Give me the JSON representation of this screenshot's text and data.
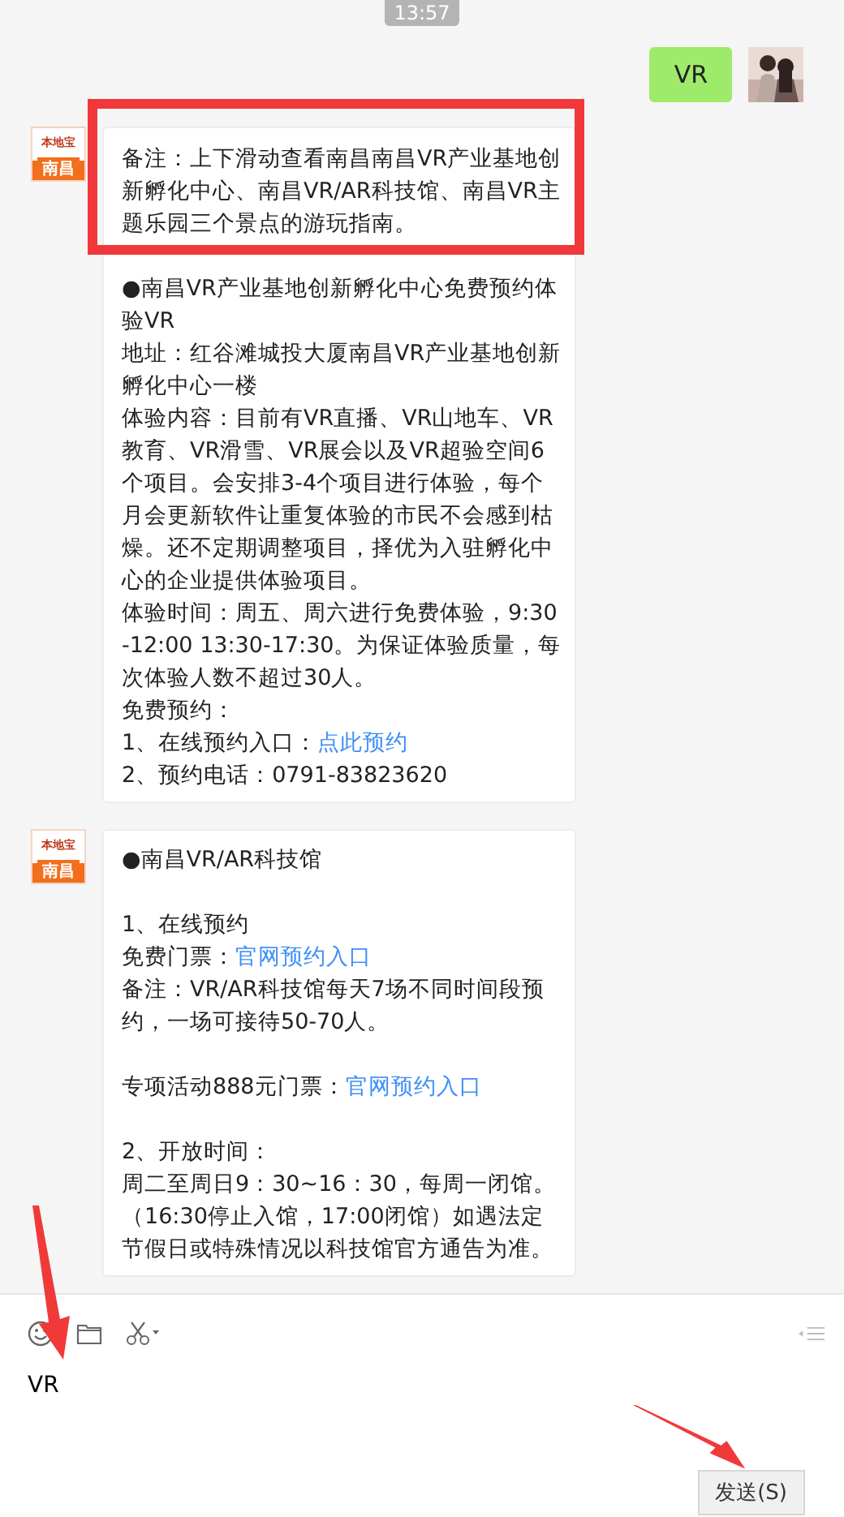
{
  "timestamp": "13:57",
  "messages": [
    {
      "kind": "sent",
      "avatar": {
        "kind": "picture"
      },
      "lines": [
        {
          "kind": "text",
          "text": "VR"
        }
      ]
    },
    {
      "kind": "received",
      "avatar": {
        "kind": "logo",
        "brand": "本地宝",
        "city": "南昌"
      },
      "highlight_first": true,
      "lines": [
        {
          "kind": "text",
          "text": "备注：上下滑动查看南昌南昌VR产业基地创新孵化中心、南昌VR/AR科技馆、南昌VR主题乐园三个景点的游玩指南。"
        },
        {
          "kind": "gap"
        },
        {
          "kind": "text",
          "text": "●南昌VR产业基地创新孵化中心免费预约体验VR"
        },
        {
          "kind": "text",
          "text": "地址：红谷滩城投大厦南昌VR产业基地创新孵化中心一楼"
        },
        {
          "kind": "text",
          "text": "体验内容：目前有VR直播、VR山地车、VR教育、VR滑雪、VR展会以及VR超验空间6个项目。会安排3-4个项目进行体验，每个月会更新软件让重复体验的市民不会感到枯燥。还不定期调整项目，择优为入驻孵化中心的企业提供体验项目。"
        },
        {
          "kind": "text",
          "text": "体验时间：周五、周六进行免费体验，9:30-12:00 13:30-17:30。为保证体验质量，每次体验人数不超过30人。"
        },
        {
          "kind": "text",
          "text": "免费预约："
        },
        {
          "kind": "link",
          "text": "1、在线预约入口：",
          "link": "点此预约"
        },
        {
          "kind": "text",
          "text": "2、预约电话：0791-83823620"
        }
      ]
    },
    {
      "kind": "received",
      "avatar": {
        "kind": "logo",
        "brand": "本地宝",
        "city": "南昌"
      },
      "highlight_first": false,
      "lines": [
        {
          "kind": "text",
          "text": "●南昌VR/AR科技馆"
        },
        {
          "kind": "gap"
        },
        {
          "kind": "text",
          "text": "1、在线预约"
        },
        {
          "kind": "link",
          "text": "免费门票：",
          "link": "官网预约入口"
        },
        {
          "kind": "text",
          "text": "备注：VR/AR科技馆每天7场不同时间段预约，一场可接待50-70人。"
        },
        {
          "kind": "gap"
        },
        {
          "kind": "link",
          "text": "专项活动888元门票：",
          "link": "官网预约入口"
        },
        {
          "kind": "gap"
        },
        {
          "kind": "text",
          "text": "2、开放时间："
        },
        {
          "kind": "text",
          "text": "周二至周日9：30~16：30，每周一闭馆。（16:30停止入馆，17:00闭馆）如遇法定节假日或特殊情况以科技馆官方通告为准。"
        }
      ]
    }
  ],
  "composer": {
    "value": "VR",
    "send_button": "发送(S)"
  },
  "annotations": [
    {
      "kind": "arrow"
    },
    {
      "kind": "arrow"
    }
  ]
}
